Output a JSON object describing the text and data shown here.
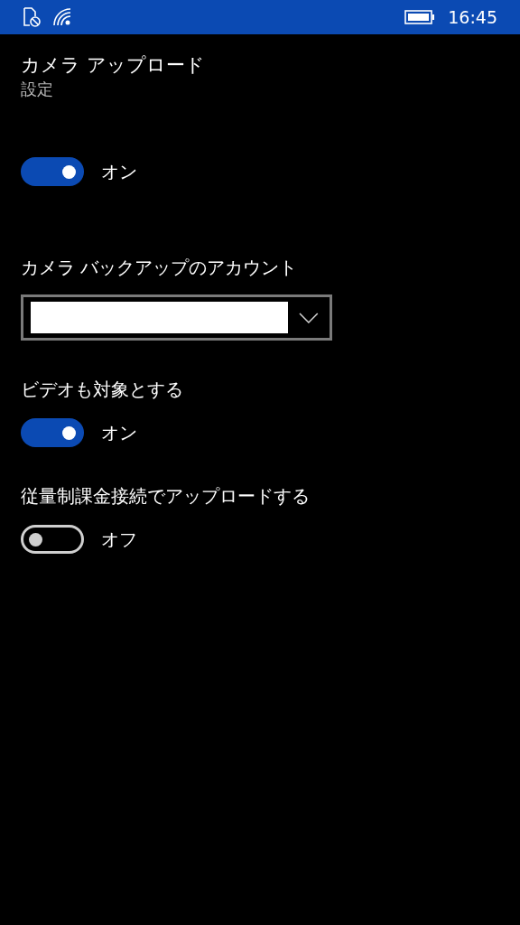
{
  "status_bar": {
    "time": "16:45"
  },
  "header": {
    "title": "カメラ アップロード",
    "subtitle": "設定"
  },
  "settings": [
    {
      "kind": "toggle",
      "on": true,
      "state_label": "オン"
    },
    {
      "kind": "dropdown",
      "label": "カメラ バックアップのアカウント"
    },
    {
      "kind": "toggle",
      "label": "ビデオも対象とする",
      "on": true,
      "state_label": "オン"
    },
    {
      "kind": "toggle",
      "label": "従量制課金接続でアップロードする",
      "on": false,
      "state_label": "オフ"
    }
  ]
}
